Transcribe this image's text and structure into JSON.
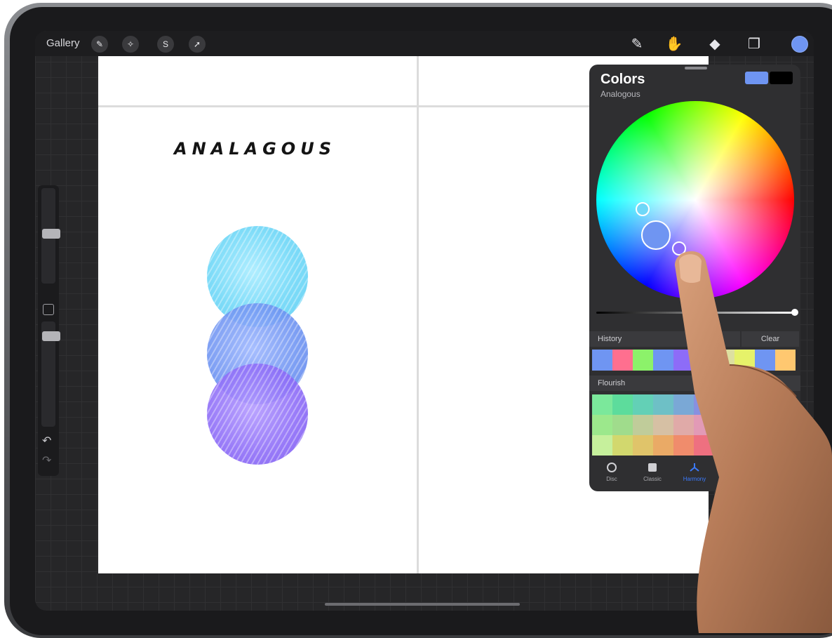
{
  "toolbar": {
    "gallery_label": "Gallery",
    "left_tools": [
      {
        "icon": "wrench-icon",
        "glyph": "✎"
      },
      {
        "icon": "magic-wand-icon",
        "glyph": "✧"
      },
      {
        "icon": "selection-icon",
        "glyph": "S"
      },
      {
        "icon": "transform-arrow-icon",
        "glyph": "➚"
      }
    ],
    "right_tools": [
      {
        "icon": "brush-icon",
        "glyph": "✎"
      },
      {
        "icon": "smudge-icon",
        "glyph": "✋"
      },
      {
        "icon": "eraser-icon",
        "glyph": "◆"
      },
      {
        "icon": "layers-icon",
        "glyph": "❐"
      }
    ],
    "current_color": "#6f95f2"
  },
  "canvas": {
    "title": "ANALAGOUS",
    "circle_colors": [
      "#6fd8f8",
      "#6f95f2",
      "#8d6cf8"
    ]
  },
  "sidebar": {
    "undo": "↶",
    "redo": "↷"
  },
  "colors_panel": {
    "title": "Colors",
    "mode": "Analogous",
    "primary_color": "#6f95f2",
    "secondary_color": "#000000",
    "history_label": "History",
    "clear_label": "Clear",
    "history": [
      "#6f95f2",
      "#ff6f8f",
      "#8cf26a",
      "#6f95f2",
      "#8d6cf8",
      "#f0a0c0",
      "#dde0a0",
      "#e6f26a",
      "#6f95f2",
      "#ffc870"
    ],
    "palette_label": "Flourish",
    "palette": [
      "#7be89b",
      "#5ddc9c",
      "#63d0b6",
      "#6ec0c6",
      "#7aa8d6",
      "#8890e0",
      "#9a7ee6",
      "#a870e8",
      "#b066e6",
      "#7a62f0",
      "#9ce88c",
      "#a0dc8c",
      "#c0cc9a",
      "#d6c0a4",
      "#e0aaa8",
      "#e29ab6",
      "#e08ec4",
      "#dc84cc",
      "#d47ad0",
      "#c870d2",
      "#c6f09c",
      "#d2d86e",
      "#e0c46a",
      "#eaaa66",
      "#f08c6c",
      "#ee7080",
      "#e6649a",
      "#dc5eb2",
      "#d05cc4",
      "#c45ad0"
    ],
    "tabs": [
      {
        "label": "Disc",
        "icon": "disc-icon"
      },
      {
        "label": "Classic",
        "icon": "classic-square-icon"
      },
      {
        "label": "Harmony",
        "icon": "harmony-icon"
      }
    ]
  }
}
